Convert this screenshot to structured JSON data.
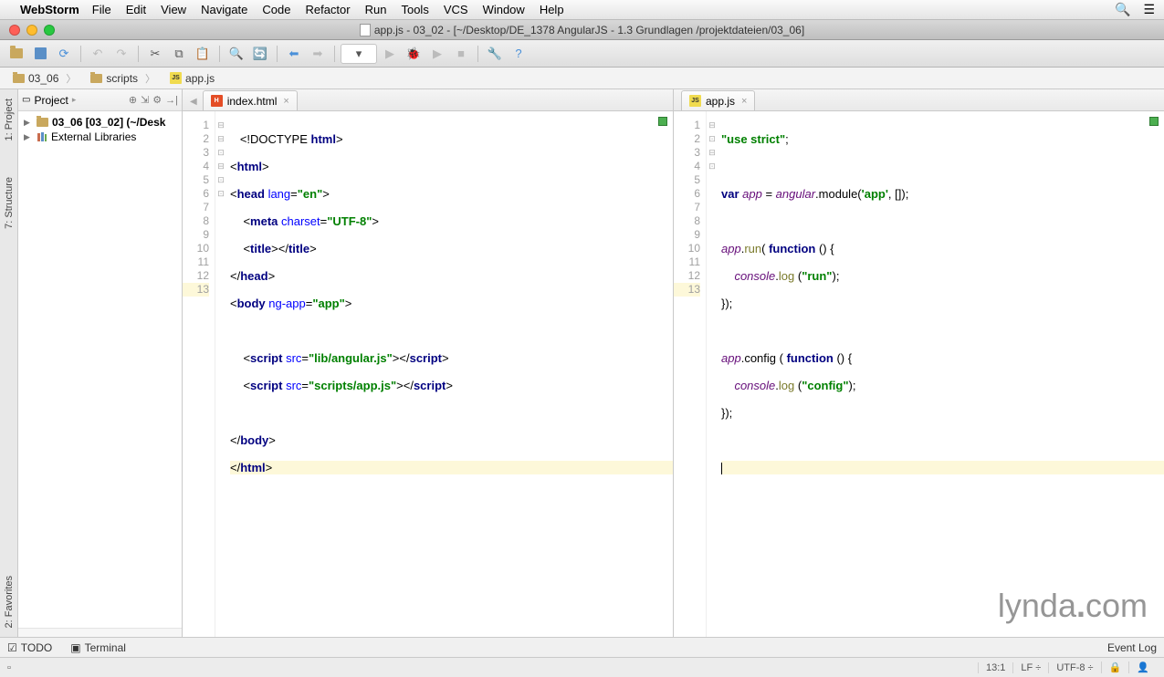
{
  "mac_menu": {
    "app": "WebStorm",
    "items": [
      "File",
      "Edit",
      "View",
      "Navigate",
      "Code",
      "Refactor",
      "Run",
      "Tools",
      "VCS",
      "Window",
      "Help"
    ]
  },
  "window_title": "app.js - 03_02 - [~/Desktop/DE_1378 AngularJS - 1.3 Grundlagen /projektdateien/03_06]",
  "breadcrumbs": [
    {
      "icon": "folder",
      "label": "03_06"
    },
    {
      "icon": "folder",
      "label": "scripts"
    },
    {
      "icon": "js",
      "label": "app.js"
    }
  ],
  "side_tabs": {
    "project": "1: Project",
    "structure": "7: Structure",
    "favorites": "2: Favorites"
  },
  "project_panel": {
    "title": "Project",
    "root": "03_06 [03_02] (~/Desk",
    "external": "External Libraries"
  },
  "left_editor": {
    "tab": "index.html",
    "lines": [
      "1",
      "2",
      "3",
      "4",
      "5",
      "6",
      "7",
      "8",
      "9",
      "10",
      "11",
      "12",
      "13"
    ],
    "code": {
      "l1": {
        "a": "<!DOCTYPE ",
        "b": "html",
        "c": ">"
      },
      "l2": {
        "a": "<",
        "b": "html",
        "c": ">"
      },
      "l3": {
        "a": "<",
        "b": "head ",
        "c": "lang",
        "d": "=",
        "e": "\"en\"",
        "f": ">"
      },
      "l4": {
        "a": "<",
        "b": "meta ",
        "c": "charset",
        "d": "=",
        "e": "\"UTF-8\"",
        "f": ">"
      },
      "l5": {
        "a": "<",
        "b": "title",
        "c": "></",
        "d": "title",
        "e": ">"
      },
      "l6": {
        "a": "</",
        "b": "head",
        "c": ">"
      },
      "l7": {
        "a": "<",
        "b": "body ",
        "c": "ng-app",
        "d": "=",
        "e": "\"app\"",
        "f": ">"
      },
      "l9": {
        "a": "<",
        "b": "script ",
        "c": "src",
        "d": "=",
        "e": "\"lib/angular.js\"",
        "f": "></",
        "g": "script",
        "h": ">"
      },
      "l10": {
        "a": "<",
        "b": "script ",
        "c": "src",
        "d": "=",
        "e": "\"scripts/app.js\"",
        "f": "></",
        "g": "script",
        "h": ">"
      },
      "l12": {
        "a": "</",
        "b": "body",
        "c": ">"
      },
      "l13": {
        "a": "</",
        "b": "html",
        "c": ">"
      }
    }
  },
  "right_editor": {
    "tab": "app.js",
    "lines": [
      "1",
      "2",
      "3",
      "4",
      "5",
      "6",
      "7",
      "8",
      "9",
      "10",
      "11",
      "12",
      "13"
    ],
    "code": {
      "l1": {
        "a": "\"use strict\"",
        "b": ";"
      },
      "l3": {
        "a": "var ",
        "b": "app",
        "c": " = ",
        "d": "angular",
        "e": ".module(",
        "f": "'app'",
        "g": ", []);"
      },
      "l5": {
        "a": "app",
        "b": ".",
        "c": "run",
        "d": "( ",
        "e": "function ",
        "f": "() {"
      },
      "l6": {
        "a": "console",
        "b": ".",
        "c": "log",
        "d": " (",
        "e": "\"run\"",
        "f": ");"
      },
      "l7": {
        "a": "});"
      },
      "l9": {
        "a": "app",
        "b": ".config ( ",
        "c": "function ",
        "d": "() {"
      },
      "l10": {
        "a": "console",
        "b": ".",
        "c": "log",
        "d": " (",
        "e": "\"config\"",
        "f": ");"
      },
      "l11": {
        "a": "});"
      }
    }
  },
  "bottom_tools": {
    "todo": "TODO",
    "terminal": "Terminal",
    "event_log": "Event Log"
  },
  "status_bar": {
    "pos": "13:1",
    "line_sep": "LF",
    "encoding": "UTF-8"
  },
  "watermark": "lynda.com"
}
